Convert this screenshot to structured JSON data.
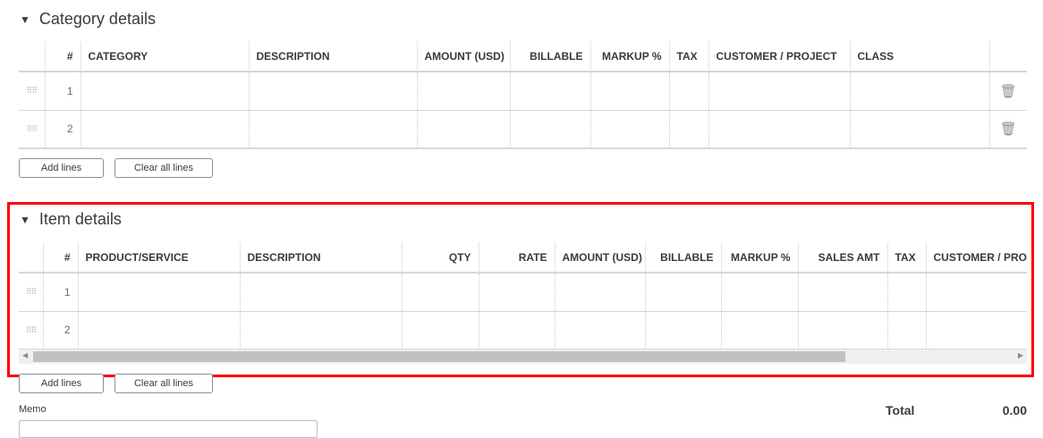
{
  "category": {
    "title": "Category details",
    "columns": [
      "#",
      "CATEGORY",
      "DESCRIPTION",
      "AMOUNT (USD)",
      "BILLABLE",
      "MARKUP %",
      "TAX",
      "CUSTOMER / PROJECT",
      "CLASS"
    ],
    "rows": [
      "1",
      "2"
    ],
    "add_lines": "Add lines",
    "clear_lines": "Clear all lines"
  },
  "item": {
    "title": "Item details",
    "columns": [
      "#",
      "PRODUCT/SERVICE",
      "DESCRIPTION",
      "QTY",
      "RATE",
      "AMOUNT (USD)",
      "BILLABLE",
      "MARKUP %",
      "SALES AMT",
      "TAX",
      "CUSTOMER / PROJECT"
    ],
    "rows": [
      "1",
      "2"
    ],
    "add_lines": "Add lines",
    "clear_lines": "Clear all lines"
  },
  "memo_label": "Memo",
  "total_label": "Total",
  "total_value": "0.00",
  "highlight_color": "#ff0000"
}
